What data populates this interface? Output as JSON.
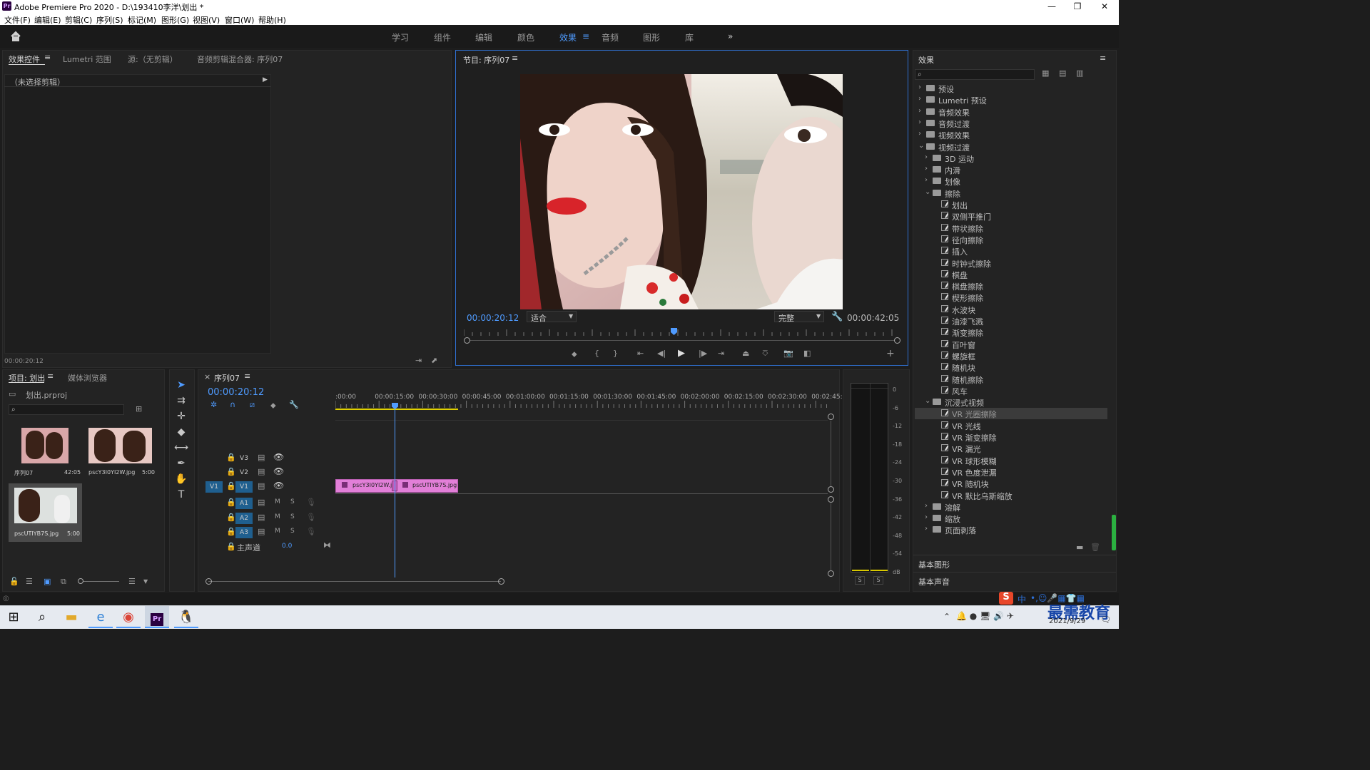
{
  "window": {
    "title": "Adobe Premiere Pro 2020 - D:\\193410李洋\\划出 *",
    "logo": "Pr",
    "controls": [
      "—",
      "❐",
      "✕"
    ]
  },
  "menu": [
    "文件(F)",
    "编辑(E)",
    "剪辑(C)",
    "序列(S)",
    "标记(M)",
    "图形(G)",
    "视图(V)",
    "窗口(W)",
    "帮助(H)"
  ],
  "workspaces": {
    "tabs": [
      "学习",
      "组件",
      "编辑",
      "颜色",
      "效果",
      "音频",
      "图形",
      "库"
    ],
    "active": "效果",
    "more": "»"
  },
  "effect_controls": {
    "tabs": [
      "效果控件",
      "Lumetri 范围",
      "源:（无剪辑）",
      "音频剪辑混合器: 序列07"
    ],
    "no_clip": "（未选择剪辑）",
    "timecode": "00:00:20:12"
  },
  "program": {
    "title": "节目: 序列07",
    "timecode": "00:00:20:12",
    "fit": "适合",
    "quality": "完整",
    "duration": "00:00:42:05",
    "playhead_fraction": 0.48
  },
  "effects": {
    "title": "效果",
    "tree": [
      {
        "label": "预设",
        "level": 0,
        "expanded": false,
        "type": "folder"
      },
      {
        "label": "Lumetri 预设",
        "level": 0,
        "expanded": false,
        "type": "folder"
      },
      {
        "label": "音频效果",
        "level": 0,
        "expanded": false,
        "type": "folder"
      },
      {
        "label": "音频过渡",
        "level": 0,
        "expanded": false,
        "type": "folder"
      },
      {
        "label": "视频效果",
        "level": 0,
        "expanded": false,
        "type": "folder"
      },
      {
        "label": "视频过渡",
        "level": 0,
        "expanded": true,
        "type": "folder"
      },
      {
        "label": "3D 运动",
        "level": 1,
        "expanded": false,
        "type": "folder"
      },
      {
        "label": "内滑",
        "level": 1,
        "expanded": false,
        "type": "folder"
      },
      {
        "label": "划像",
        "level": 1,
        "expanded": false,
        "type": "folder"
      },
      {
        "label": "擦除",
        "level": 1,
        "expanded": true,
        "type": "folder"
      },
      {
        "label": "划出",
        "level": 2,
        "type": "fx"
      },
      {
        "label": "双侧平推门",
        "level": 2,
        "type": "fx"
      },
      {
        "label": "带状擦除",
        "level": 2,
        "type": "fx"
      },
      {
        "label": "径向擦除",
        "level": 2,
        "type": "fx"
      },
      {
        "label": "插入",
        "level": 2,
        "type": "fx"
      },
      {
        "label": "时钟式擦除",
        "level": 2,
        "type": "fx"
      },
      {
        "label": "棋盘",
        "level": 2,
        "type": "fx"
      },
      {
        "label": "棋盘擦除",
        "level": 2,
        "type": "fx"
      },
      {
        "label": "楔形擦除",
        "level": 2,
        "type": "fx"
      },
      {
        "label": "水波块",
        "level": 2,
        "type": "fx"
      },
      {
        "label": "油漆飞溅",
        "level": 2,
        "type": "fx"
      },
      {
        "label": "渐变擦除",
        "level": 2,
        "type": "fx"
      },
      {
        "label": "百叶窗",
        "level": 2,
        "type": "fx"
      },
      {
        "label": "螺旋框",
        "level": 2,
        "type": "fx"
      },
      {
        "label": "随机块",
        "level": 2,
        "type": "fx"
      },
      {
        "label": "随机擦除",
        "level": 2,
        "type": "fx"
      },
      {
        "label": "风车",
        "level": 2,
        "type": "fx"
      },
      {
        "label": "沉浸式视频",
        "level": 1,
        "expanded": true,
        "type": "folder"
      },
      {
        "label": "VR 光圈擦除",
        "level": 2,
        "type": "fx",
        "selected": true
      },
      {
        "label": "VR 光线",
        "level": 2,
        "type": "fx"
      },
      {
        "label": "VR 渐变擦除",
        "level": 2,
        "type": "fx"
      },
      {
        "label": "VR 漏光",
        "level": 2,
        "type": "fx"
      },
      {
        "label": "VR 球形模糊",
        "level": 2,
        "type": "fx"
      },
      {
        "label": "VR 色度泄漏",
        "level": 2,
        "type": "fx"
      },
      {
        "label": "VR 随机块",
        "level": 2,
        "type": "fx"
      },
      {
        "label": "VR 默比乌斯缩放",
        "level": 2,
        "type": "fx"
      },
      {
        "label": "溶解",
        "level": 1,
        "expanded": false,
        "type": "folder"
      },
      {
        "label": "缩放",
        "level": 1,
        "expanded": false,
        "type": "folder"
      },
      {
        "label": "页面剥落",
        "level": 1,
        "expanded": false,
        "type": "folder"
      }
    ],
    "sections": [
      "基本图形",
      "基本声音"
    ]
  },
  "project": {
    "tabs": [
      "项目: 划出",
      "媒体浏览器"
    ],
    "file": "划出.prproj",
    "items": [
      {
        "name": "序列07",
        "dur": "42:05"
      },
      {
        "name": "pscY3I0YI2W.jpg",
        "dur": "5:00"
      },
      {
        "name": "pscUTIYB7S.jpg",
        "dur": "5:00"
      }
    ]
  },
  "timeline": {
    "tab": "序列07",
    "timecode": "00:00:20:12",
    "ruler": [
      ":00:00",
      "00:00:15:00",
      "00:00:30:00",
      "00:00:45:00",
      "00:01:00:00",
      "00:01:15:00",
      "00:01:30:00",
      "00:01:45:00",
      "00:02:00:00",
      "00:02:15:00",
      "00:02:30:00",
      "00:02:45:"
    ],
    "video_tracks": [
      "V3",
      "V2",
      "V1"
    ],
    "audio_tracks": [
      "A1",
      "A2",
      "A3"
    ],
    "source_patch": "V1",
    "master": {
      "label": "主声道",
      "value": "0.0"
    },
    "msr": [
      "M",
      "S"
    ],
    "clips": [
      {
        "name": "pscY3I0YI2W.jpg"
      },
      {
        "name": "pscUTIYB7S.jpg"
      }
    ]
  },
  "meter": {
    "scale": [
      "0",
      "-6",
      "-12",
      "-18",
      "-24",
      "-30",
      "-36",
      "-42",
      "-48",
      "-54",
      "dB"
    ],
    "solo": [
      "S",
      "S"
    ]
  },
  "taskbar": {
    "date": "2021/9/29",
    "watermark": "最需教育",
    "ime": "中"
  }
}
